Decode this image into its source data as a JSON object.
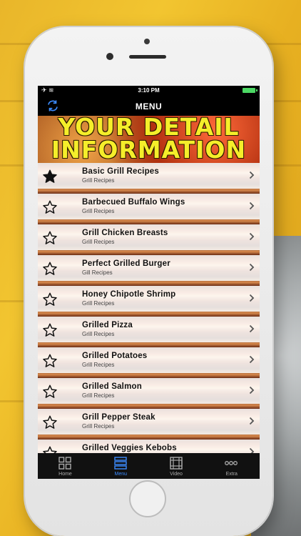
{
  "status_bar": {
    "time": "3:10 PM"
  },
  "nav": {
    "title": "MENU",
    "left_icon": "refresh-icon"
  },
  "banner": {
    "line1": "YOUR DETAIL",
    "line2": "INFORMATION"
  },
  "recipes": [
    {
      "title": "Basic Grill Recipes",
      "subtitle": "Grill Recipes",
      "favorite": true
    },
    {
      "title": "Barbecued Buffalo Wings",
      "subtitle": "Grill Recipes",
      "favorite": false
    },
    {
      "title": "Grill Chicken Breasts",
      "subtitle": "Grill Recipes",
      "favorite": false
    },
    {
      "title": "Perfect Grilled Burger",
      "subtitle": "Gill Recipes",
      "favorite": false
    },
    {
      "title": "Honey Chipotle Shrimp",
      "subtitle": "Grill Recipes",
      "favorite": false
    },
    {
      "title": "Grilled Pizza",
      "subtitle": "Grill Recipes",
      "favorite": false
    },
    {
      "title": "Grilled Potatoes",
      "subtitle": "Grill Recipes",
      "favorite": false
    },
    {
      "title": "Grilled Salmon",
      "subtitle": "Grill Recipes",
      "favorite": false
    },
    {
      "title": "Grill Pepper Steak",
      "subtitle": "Grill Recipes",
      "favorite": false
    },
    {
      "title": "Grilled Veggies Kebobs",
      "subtitle": "",
      "favorite": false
    }
  ],
  "tabs": [
    {
      "label": "Home",
      "icon": "grid-icon",
      "active": false
    },
    {
      "label": "Menu",
      "icon": "list-icon",
      "active": true
    },
    {
      "label": "Video",
      "icon": "film-icon",
      "active": false
    },
    {
      "label": "Extra",
      "icon": "more-icon",
      "active": false
    }
  ],
  "colors": {
    "banner_text": "#f5ee2a",
    "tab_active": "#3c8cff",
    "battery": "#4cd964"
  }
}
